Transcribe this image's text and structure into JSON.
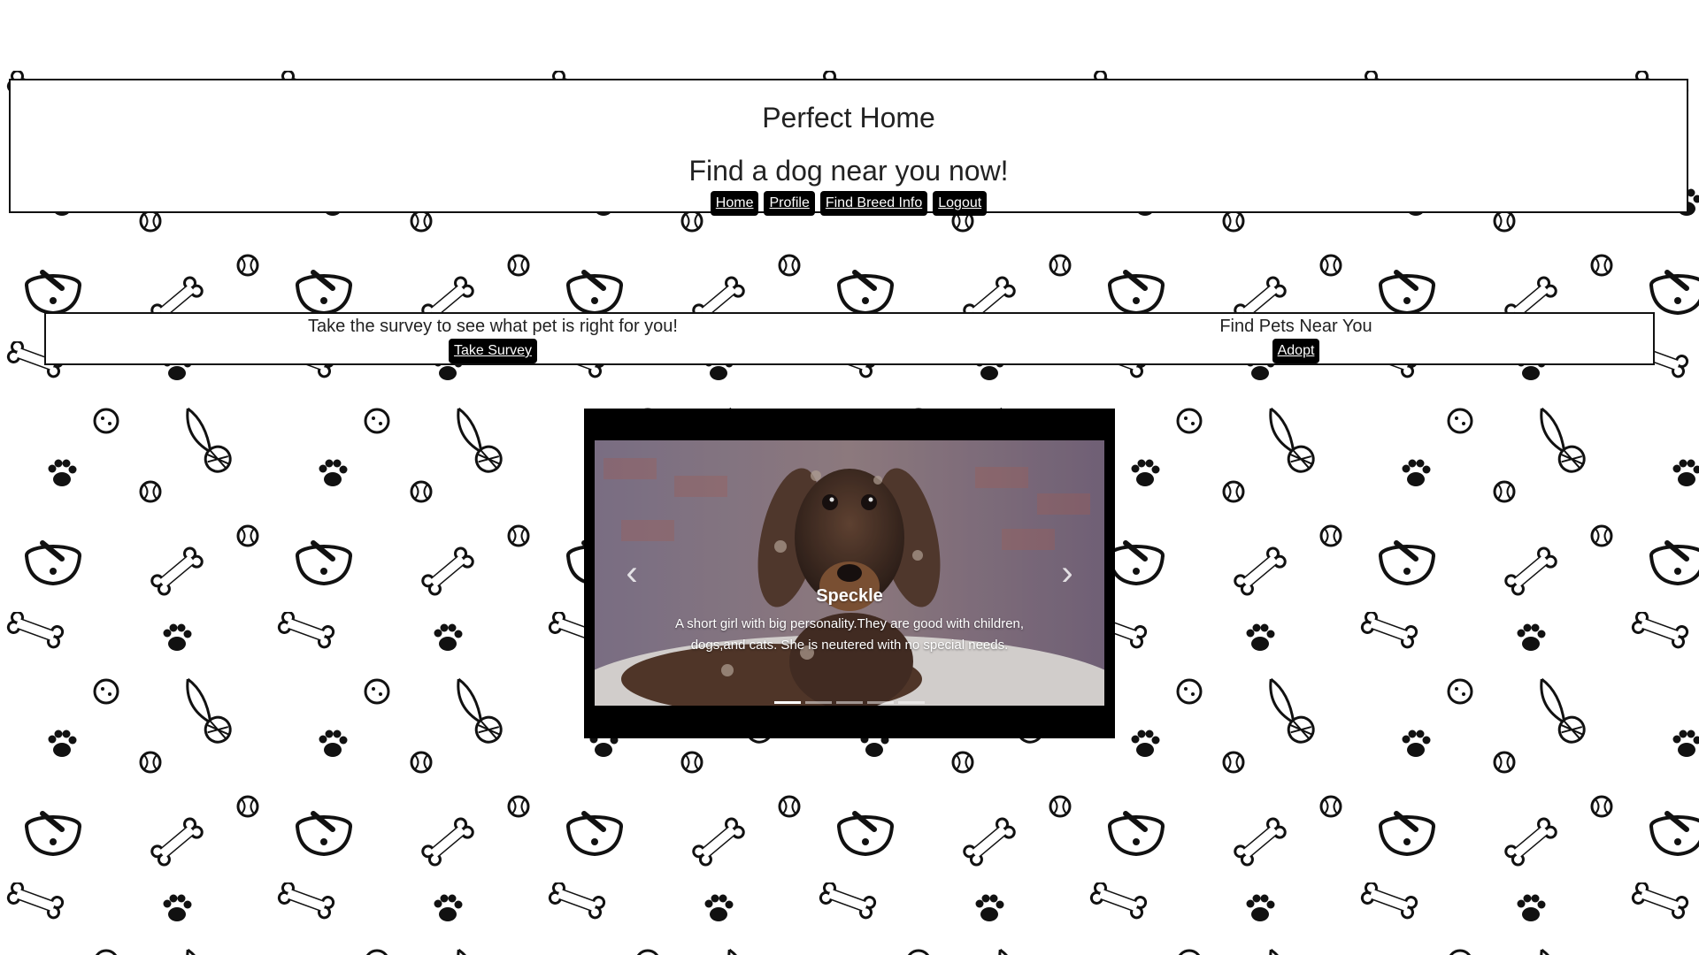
{
  "header": {
    "title": "Perfect Home",
    "subtitle": "Find a dog near you now!",
    "nav": [
      {
        "label": "Home"
      },
      {
        "label": "Profile"
      },
      {
        "label": "Find Breed Info"
      },
      {
        "label": "Logout"
      }
    ]
  },
  "cta": {
    "survey_text": "Take the survey to see what pet is right for you!",
    "survey_button": "Take Survey",
    "pets_text": "Find Pets Near You",
    "pets_button": "Adopt"
  },
  "carousel": {
    "slide_title": "Speckle",
    "slide_text": "A short girl with big personality.They are good with children, dogs,and cats. She is neutered with no special needs.",
    "prev_icon": "chevron-left-icon",
    "next_icon": "chevron-right-icon",
    "indicator_count": 5,
    "active_index": 0
  },
  "colors": {
    "background": "#ffffff",
    "button_bg": "#000000",
    "button_text": "#ffffff",
    "border": "#111111"
  }
}
